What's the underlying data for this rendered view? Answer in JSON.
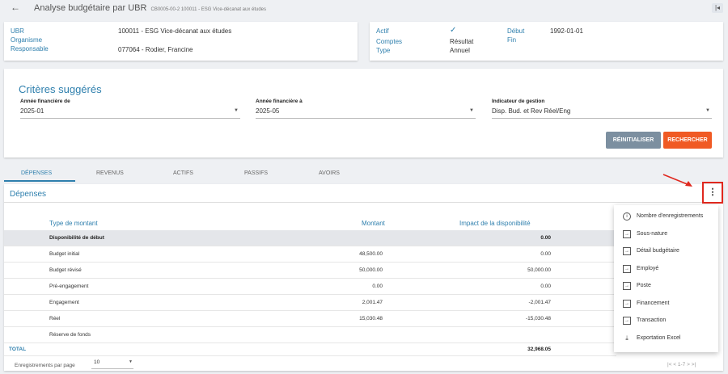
{
  "header": {
    "title": "Analyse budgétaire par UBR",
    "subtitle": "CB0005-00-2 100011 - ESG Vice-décanat aux études"
  },
  "info_left": {
    "ubr_label": "UBR",
    "ubr_value": "100011 - ESG Vice-décanat aux études",
    "org_label": "Organisme",
    "resp_label": "Responsable",
    "resp_value": "077064 - Rodier, Francine"
  },
  "info_right": {
    "actif_label": "Actif",
    "comptes_label": "Comptes",
    "comptes_value": "Résultat",
    "type_label": "Type",
    "type_value": "Annuel",
    "debut_label": "Début",
    "debut_value": "1992-01-01",
    "fin_label": "Fin"
  },
  "criteria": {
    "title": "Critères suggérés",
    "annee_de_label": "Année financière de",
    "annee_de_value": "2025-01",
    "annee_a_label": "Année financière à",
    "annee_a_value": "2025-05",
    "indicateur_label": "Indicateur de gestion",
    "indicateur_value": "Disp. Bud. et Rev Réel/Eng",
    "reset_label": "RÉINITIALISER",
    "search_label": "RECHERCHER"
  },
  "tabs": [
    "DÉPENSES",
    "REVENUS",
    "ACTIFS",
    "PASSIFS",
    "AVOIRS"
  ],
  "section": {
    "title": "Dépenses"
  },
  "table": {
    "headers": [
      "Type de montant",
      "Montant",
      "Impact de la disponibilité"
    ],
    "rows": [
      {
        "type": "Disponibilité de début",
        "montant": "",
        "impact": "0.00"
      },
      {
        "type": "Budget initial",
        "montant": "48,500.00",
        "impact": "0.00"
      },
      {
        "type": "Budget révisé",
        "montant": "50,000.00",
        "impact": "50,000.00"
      },
      {
        "type": "Pré-engagement",
        "montant": "0.00",
        "impact": "0.00"
      },
      {
        "type": "Engagement",
        "montant": "2,001.47",
        "impact": "-2,001.47"
      },
      {
        "type": "Réel",
        "montant": "15,030.48",
        "impact": "-15,030.48"
      },
      {
        "type": "Réserve de fonds",
        "montant": "",
        "impact": ""
      }
    ],
    "total_label": "TOTAL",
    "total_value": "32,968.05"
  },
  "footer": {
    "per_page_label": "Enregistrements par page",
    "per_page_value": "10",
    "pager_text": "|< < 1-7 > >|"
  },
  "menu": {
    "items": [
      {
        "label": "Nombre d'enregistrements",
        "icon": "info-icon"
      },
      {
        "label": "Sous-nature",
        "icon": "arrow-box-icon"
      },
      {
        "label": "Détail budgétaire",
        "icon": "arrow-box-icon"
      },
      {
        "label": "Employé",
        "icon": "arrow-box-icon"
      },
      {
        "label": "Poste",
        "icon": "arrow-box-icon"
      },
      {
        "label": "Financement",
        "icon": "arrow-box-icon"
      },
      {
        "label": "Transaction",
        "icon": "arrow-box-icon"
      },
      {
        "label": "Exportation Excel",
        "icon": "download-icon"
      }
    ]
  },
  "colors": {
    "accent": "#2e7fad",
    "search_button": "#f05a24",
    "reset_button": "#7c8fa0",
    "highlight": "#e0281e"
  }
}
